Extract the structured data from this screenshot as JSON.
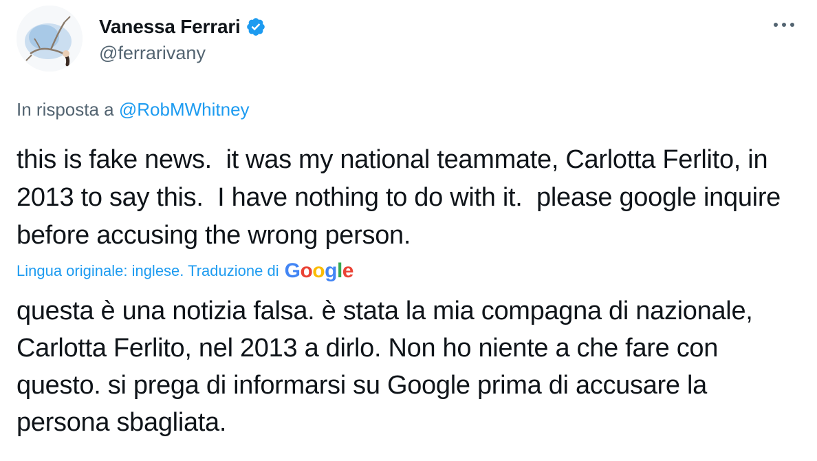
{
  "author": {
    "display_name": "Vanessa Ferrari",
    "handle": "@ferrarivany",
    "verified": true,
    "avatar": "gymnast-illustration-avatar"
  },
  "reply": {
    "prefix": "In risposta a ",
    "to": "@RobMWhitney"
  },
  "tweet": {
    "text": "this is fake news.  it was my national teammate, Carlotta Ferlito, in 2013 to say this.  I have nothing to do with it.  please google inquire before accusing the wrong person.",
    "translation_note": "Lingua originale: inglese. Traduzione di",
    "translation_provider": "Google",
    "translated_text": "questa è una notizia falsa. è stata la mia compagna di nazionale, Carlotta Ferlito, nel 2013 a dirlo. Non ho niente a che fare con questo. si prega di informarsi su Google prima di accusare la persona sbagliata."
  },
  "colors": {
    "accent": "#1d9bf0",
    "secondary_text": "#536471",
    "primary_text": "#0f1419"
  },
  "icons": {
    "verified": "verified-badge-icon",
    "more": "more-options-icon"
  }
}
